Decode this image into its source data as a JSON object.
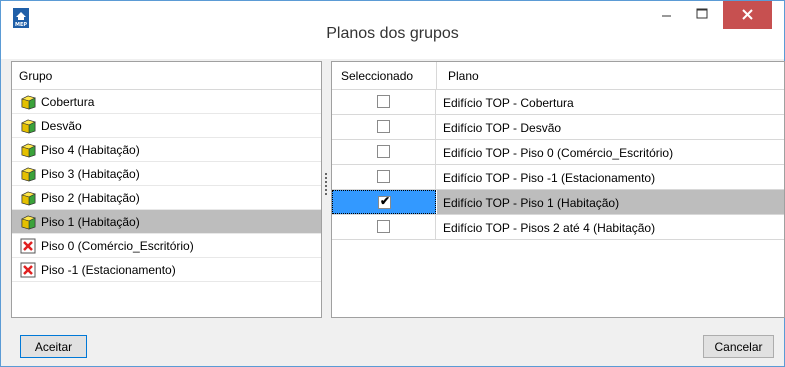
{
  "window": {
    "title": "Planos dos grupos",
    "app_icon": "cype-mep-icon",
    "app_icon_text": "MEP"
  },
  "left_panel": {
    "header": "Grupo",
    "items": [
      {
        "label": "Cobertura",
        "icon": "group-cube-icon",
        "selected": false
      },
      {
        "label": "Desvão",
        "icon": "group-cube-icon",
        "selected": false
      },
      {
        "label": "Piso 4 (Habitação)",
        "icon": "group-cube-icon",
        "selected": false
      },
      {
        "label": "Piso 3 (Habitação)",
        "icon": "group-cube-icon",
        "selected": false
      },
      {
        "label": "Piso 2 (Habitação)",
        "icon": "group-cube-icon",
        "selected": false
      },
      {
        "label": "Piso 1 (Habitação)",
        "icon": "group-cube-icon",
        "selected": true
      },
      {
        "label": "Piso 0 (Comércio_Escritório)",
        "icon": "red-x-icon",
        "selected": false
      },
      {
        "label": "Piso -1 (Estacionamento)",
        "icon": "red-x-icon",
        "selected": false
      }
    ]
  },
  "right_panel": {
    "columns": [
      "Seleccionado",
      "Plano"
    ],
    "rows": [
      {
        "checked": false,
        "plano": "Edifício TOP - Cobertura",
        "selected": false
      },
      {
        "checked": false,
        "plano": "Edifício TOP - Desvão",
        "selected": false
      },
      {
        "checked": false,
        "plano": "Edifício TOP - Piso 0 (Comércio_Escritório)",
        "selected": false
      },
      {
        "checked": false,
        "plano": "Edifício TOP - Piso -1 (Estacionamento)",
        "selected": false
      },
      {
        "checked": true,
        "plano": "Edifício TOP - Piso 1 (Habitação)",
        "selected": true
      },
      {
        "checked": false,
        "plano": "Edifício TOP - Pisos 2 até 4 (Habitação)",
        "selected": false
      }
    ]
  },
  "footer": {
    "ok_label": "Aceitar",
    "cancel_label": "Cancelar"
  },
  "colors": {
    "close_button": "#c75050",
    "selection_gray": "#bdbdbd",
    "selection_blue": "#3399ff",
    "window_border": "#5b9bd5"
  }
}
